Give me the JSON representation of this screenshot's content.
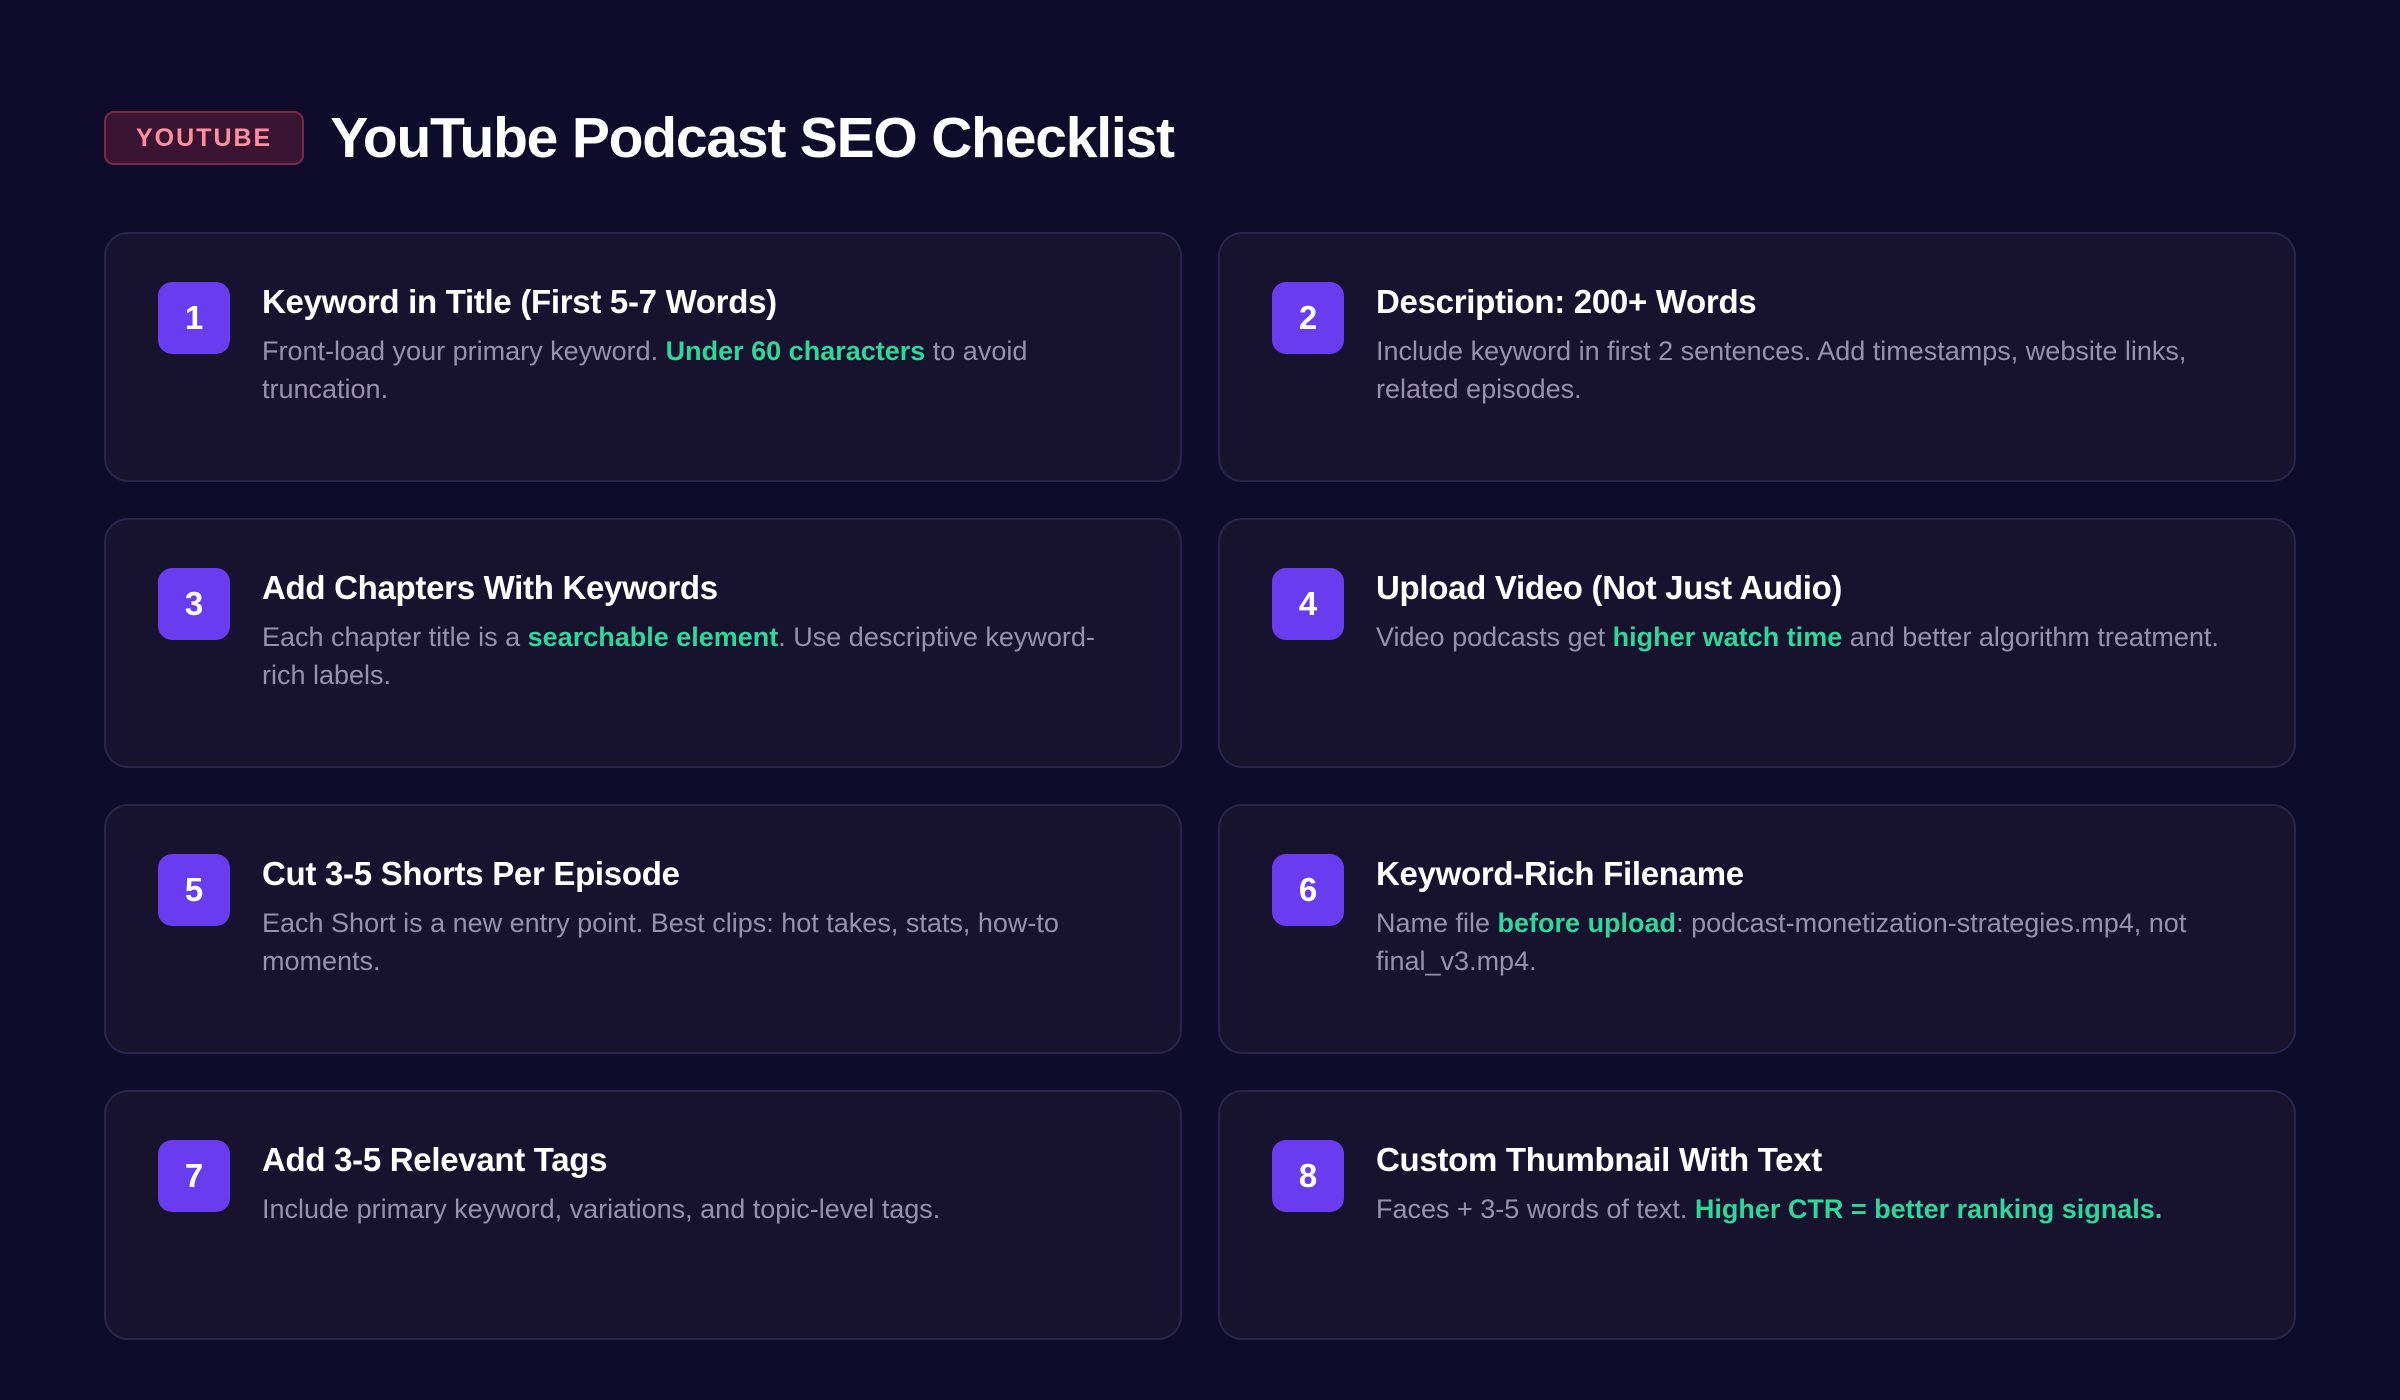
{
  "badge": "YOUTUBE",
  "title": "YouTube Podcast SEO Checklist",
  "colors": {
    "background": "#0f0b2b",
    "card": "#17132f",
    "number_badge": "#6a3cf0",
    "highlight": "#2fd79a",
    "tag": "#ff8e9e"
  },
  "items": [
    {
      "number": "1",
      "title": "Keyword in Title (First 5-7 Words)",
      "desc_before": "Front-load your primary keyword. ",
      "desc_highlight": "Under 60 characters",
      "desc_after": " to avoid truncation."
    },
    {
      "number": "2",
      "title": "Description: 200+ Words",
      "desc_before": "Include keyword in first 2 sentences. Add timestamps, website links, related episodes.",
      "desc_highlight": "",
      "desc_after": ""
    },
    {
      "number": "3",
      "title": "Add Chapters With Keywords",
      "desc_before": "Each chapter title is a ",
      "desc_highlight": "searchable element",
      "desc_after": ". Use descriptive keyword-rich labels."
    },
    {
      "number": "4",
      "title": "Upload Video (Not Just Audio)",
      "desc_before": "Video podcasts get ",
      "desc_highlight": "higher watch time",
      "desc_after": " and better algorithm treatment."
    },
    {
      "number": "5",
      "title": "Cut 3-5 Shorts Per Episode",
      "desc_before": "Each Short is a new entry point. Best clips: hot takes, stats, how-to moments.",
      "desc_highlight": "",
      "desc_after": ""
    },
    {
      "number": "6",
      "title": "Keyword-Rich Filename",
      "desc_before": "Name file ",
      "desc_highlight": "before upload",
      "desc_after": ": podcast-monetization-strategies.mp4, not final_v3.mp4."
    },
    {
      "number": "7",
      "title": "Add 3-5 Relevant Tags",
      "desc_before": "Include primary keyword, variations, and topic-level tags.",
      "desc_highlight": "",
      "desc_after": ""
    },
    {
      "number": "8",
      "title": "Custom Thumbnail With Text",
      "desc_before": "Faces + 3-5 words of text. ",
      "desc_highlight": "Higher CTR = better ranking signals.",
      "desc_after": ""
    }
  ]
}
